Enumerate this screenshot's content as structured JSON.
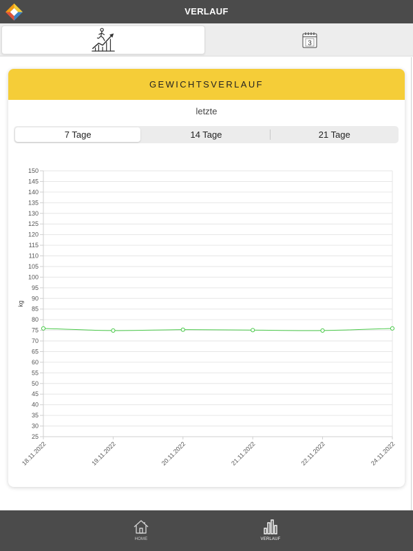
{
  "colors": {
    "topbar": "#4b4b4b",
    "accent": "#f5cd38",
    "bottom_nav": "#4b4b4b",
    "series": "#48c948"
  },
  "header": {
    "title": "VERLAUF",
    "logo_icon": "app-logo-icon"
  },
  "tabs": [
    {
      "icon": "stairs-progress-icon",
      "active": true
    },
    {
      "icon": "calendar-icon",
      "day": "3",
      "active": false
    }
  ],
  "card": {
    "title": "GEWICHTSVERLAUF",
    "subtitle": "letzte",
    "periods": [
      {
        "label": "7 Tage",
        "selected": true
      },
      {
        "label": "14 Tage",
        "selected": false
      },
      {
        "label": "21 Tage",
        "selected": false
      }
    ]
  },
  "chart_data": {
    "type": "line",
    "x": [
      "18.11.2022",
      "19.11.2022",
      "20.11.2022",
      "21.11.2022",
      "22.11.2022",
      "24.11.2022"
    ],
    "series": [
      {
        "values": [
          75.9,
          74.9,
          75.3,
          75.1,
          74.9,
          75.9
        ],
        "color": "#48c948"
      }
    ],
    "xlabel": "",
    "ylabel": "kg",
    "ylim": [
      25,
      150
    ],
    "yticks": [
      25,
      30,
      35,
      40,
      45,
      50,
      55,
      60,
      65,
      70,
      75,
      80,
      85,
      90,
      95,
      100,
      105,
      110,
      115,
      120,
      125,
      130,
      135,
      140,
      145,
      150
    ],
    "grid": true
  },
  "bottom_nav": {
    "items": [
      {
        "label": "HOME",
        "icon": "home-icon",
        "active": false
      },
      {
        "label": "VERLAUF",
        "icon": "bar-chart-icon",
        "active": true
      }
    ]
  }
}
